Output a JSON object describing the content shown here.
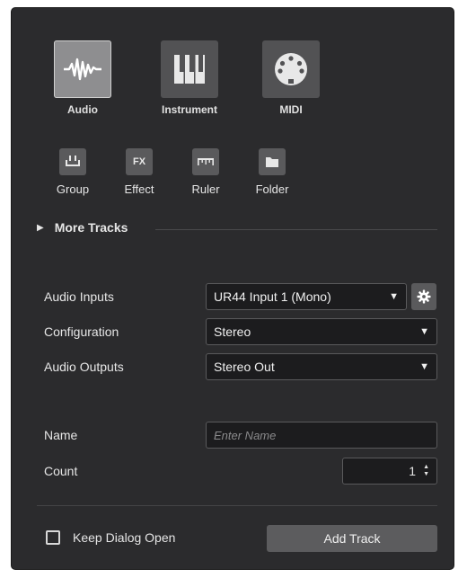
{
  "track_types": {
    "audio": {
      "label": "Audio",
      "icon": "audio-waveform-icon",
      "selected": true
    },
    "instrument": {
      "label": "Instrument",
      "icon": "piano-keys-icon"
    },
    "midi": {
      "label": "MIDI",
      "icon": "midi-connector-icon"
    }
  },
  "other_types": {
    "group": {
      "label": "Group",
      "icon": "group-icon"
    },
    "effect": {
      "label": "Effect",
      "icon_text": "FX"
    },
    "ruler": {
      "label": "Ruler",
      "icon": "ruler-icon"
    },
    "folder": {
      "label": "Folder",
      "icon": "folder-icon"
    }
  },
  "more_tracks": {
    "label": "More Tracks"
  },
  "routing": {
    "audio_inputs": {
      "label": "Audio Inputs",
      "value": "UR44 Input 1 (Mono)"
    },
    "configuration": {
      "label": "Configuration",
      "value": "Stereo"
    },
    "audio_outputs": {
      "label": "Audio Outputs",
      "value": "Stereo Out"
    }
  },
  "name": {
    "label": "Name",
    "value": "",
    "placeholder": "Enter Name"
  },
  "count": {
    "label": "Count",
    "value": "1"
  },
  "footer": {
    "keep_open_label": "Keep Dialog Open",
    "keep_open_checked": false,
    "add_label": "Add Track"
  },
  "colors": {
    "background": "#2b2b2d",
    "tile": "#525254",
    "tile_selected": "#8e8e90",
    "field": "#1c1c1e"
  }
}
